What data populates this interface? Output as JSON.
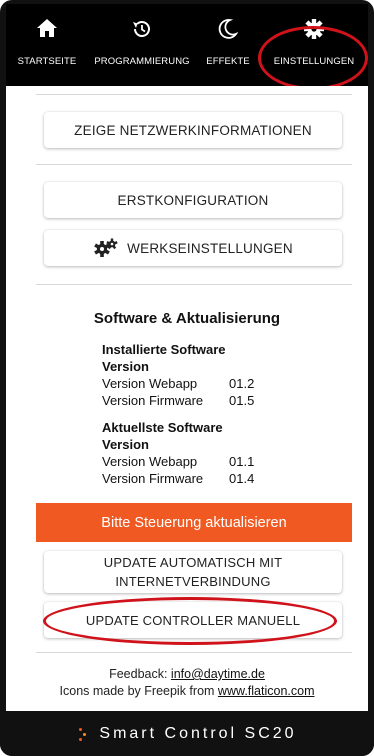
{
  "nav": {
    "tabs": [
      {
        "label": "STARTSEITE",
        "icon": "home-icon"
      },
      {
        "label": "PROGRAMMIERUNG",
        "icon": "history-icon"
      },
      {
        "label": "EFFEKTE",
        "icon": "moon-icon"
      },
      {
        "label": "EINSTELLUNGEN",
        "icon": "gear-icon",
        "active": true
      }
    ]
  },
  "buttons": {
    "network": "ZEIGE NETZWERKINFORMATIONEN",
    "initial_config": "ERSTKONFIGURATION",
    "factory_settings": "WERKSEINSTELLUNGEN",
    "update_auto_line1": "UPDATE AUTOMATISCH MIT",
    "update_auto_line2": "INTERNETVERBINDUNG",
    "update_manual": "UPDATE CONTROLLER MANUELL"
  },
  "software": {
    "heading": "Software & Aktualisierung",
    "installed": {
      "title_line1": "Installierte Software",
      "title_line2": "Version",
      "webapp_label": "Version Webapp",
      "webapp_value": "01.2",
      "firmware_label": "Version Firmware",
      "firmware_value": "01.5"
    },
    "latest": {
      "title_line1": "Aktuellste Software",
      "title_line2": "Version",
      "webapp_label": "Version Webapp",
      "webapp_value": "01.1",
      "firmware_label": "Version Firmware",
      "firmware_value": "01.4"
    }
  },
  "banner": "Bitte Steuerung aktualisieren",
  "footer": {
    "feedback_prefix": "Feedback: ",
    "email": "info@daytime.de",
    "credits_prefix": "Icons made by Freepik from ",
    "credits_link": "www.flaticon.com"
  },
  "brand": "Smart Control SC20",
  "colors": {
    "accent": "#f05a22",
    "annotation": "#d0121b"
  }
}
